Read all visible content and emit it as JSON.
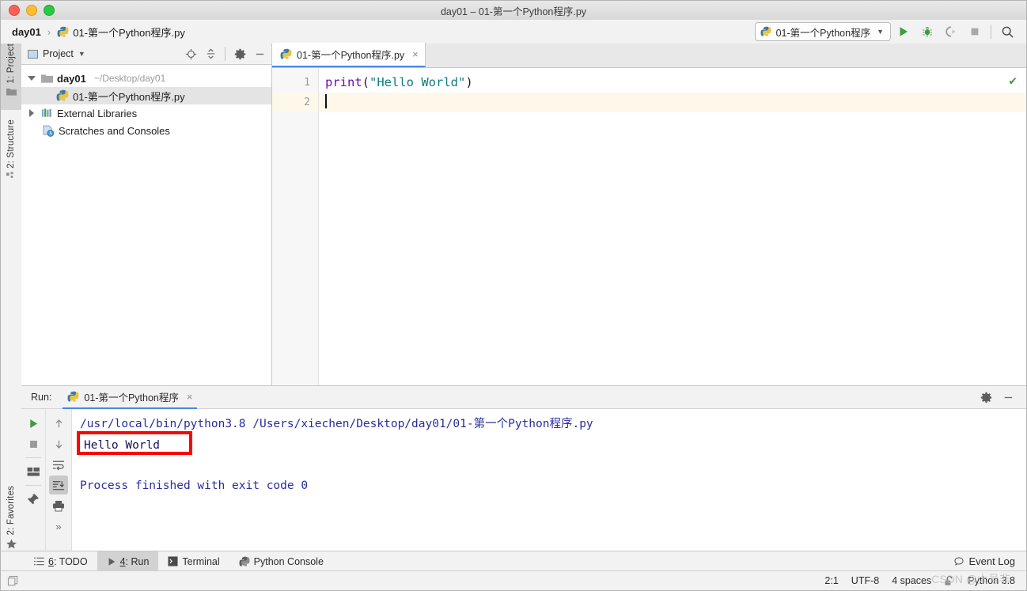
{
  "window": {
    "title": "day01 – 01-第一个Python程序.py",
    "traffic_lights": [
      "close",
      "minimize",
      "maximize"
    ]
  },
  "breadcrumb": {
    "project": "day01",
    "separator": "›",
    "file": "01-第一个Python程序.py"
  },
  "toolbar": {
    "run_config": "01-第一个Python程序",
    "caret": "▼",
    "buttons": [
      {
        "name": "run",
        "label": "Run"
      },
      {
        "name": "debug",
        "label": "Debug"
      },
      {
        "name": "coverage",
        "label": "Run with Coverage"
      },
      {
        "name": "stop",
        "label": "Stop"
      },
      {
        "name": "search",
        "label": "Search Everywhere"
      }
    ]
  },
  "left_strip": {
    "project_tab": "1: Project",
    "structure_tab": "2: Structure",
    "favorites_tab": "2: Favorites"
  },
  "project_panel": {
    "title": "Project",
    "caret": "▼",
    "icons": [
      "locate-icon",
      "collapse-all-icon",
      "settings-icon",
      "minimize-icon"
    ],
    "tree": [
      {
        "label": "day01",
        "path": "~/Desktop/day01",
        "bold": true,
        "expanded": true,
        "indent": 0,
        "icon": "folder-icon",
        "selected": false
      },
      {
        "label": "01-第一个Python程序.py",
        "path": "",
        "bold": false,
        "expanded": null,
        "indent": 2,
        "icon": "python-file-icon",
        "selected": true
      },
      {
        "label": "External Libraries",
        "path": "",
        "bold": false,
        "expanded": false,
        "indent": 0,
        "icon": "libraries-icon",
        "selected": false
      },
      {
        "label": "Scratches and Consoles",
        "path": "",
        "bold": false,
        "expanded": null,
        "indent": 1,
        "icon": "scratches-icon",
        "selected": false
      }
    ]
  },
  "editor": {
    "tab_label": "01-第一个Python程序.py",
    "tab_close": "×",
    "inspection_status": "✔",
    "lines": [
      {
        "number": "1",
        "current": false
      },
      {
        "number": "2",
        "current": true
      }
    ],
    "code": {
      "func": "print",
      "open_paren": "(",
      "string": "\"Hello World\"",
      "close_paren": ")"
    }
  },
  "run_panel": {
    "label": "Run:",
    "tab_label": "01-第一个Python程序",
    "tab_close": "×",
    "header_icons": [
      "settings-icon",
      "minimize-icon"
    ],
    "left_tools": [
      "rerun-icon",
      "stop-icon",
      "layout-icon",
      "pin-icon"
    ],
    "right_tools": [
      "up-icon",
      "down-icon",
      "soft-wrap-icon",
      "scroll-to-end-icon",
      "print-icon",
      "more-icon"
    ],
    "more": "»",
    "console": {
      "command_line": "/usr/local/bin/python3.8 /Users/xiechen/Desktop/day01/01-第一个Python程序.py",
      "output": "Hello World",
      "exit_line": "Process finished with exit code 0"
    },
    "annotation": {
      "color": "#ff0000",
      "target": "Hello World"
    }
  },
  "bottom_bar": {
    "tabs": [
      {
        "num": "6",
        "label": ": TODO",
        "icon": "todo-icon",
        "active": false
      },
      {
        "num": "4",
        "label": ": Run",
        "icon": "run-icon",
        "active": true
      },
      {
        "num": "",
        "label": "Terminal",
        "icon": "terminal-icon",
        "active": false
      },
      {
        "num": "",
        "label": "Python Console",
        "icon": "python-icon",
        "active": false
      }
    ],
    "event_log": "Event Log"
  },
  "status_bar": {
    "caret_position": "2:1",
    "encoding": "UTF-8",
    "indent": "4 spaces",
    "lock_icon": "unlocked-icon",
    "interpreter": "Python 3.8",
    "watermark": "CSDN @大号非"
  },
  "colors": {
    "accent": "#4a86e8",
    "run_green": "#3d9c40",
    "keyword": "#6a0dad",
    "string": "#0f7b7b",
    "console_text": "#2b2b9e",
    "annotation_red": "#ff0000"
  }
}
